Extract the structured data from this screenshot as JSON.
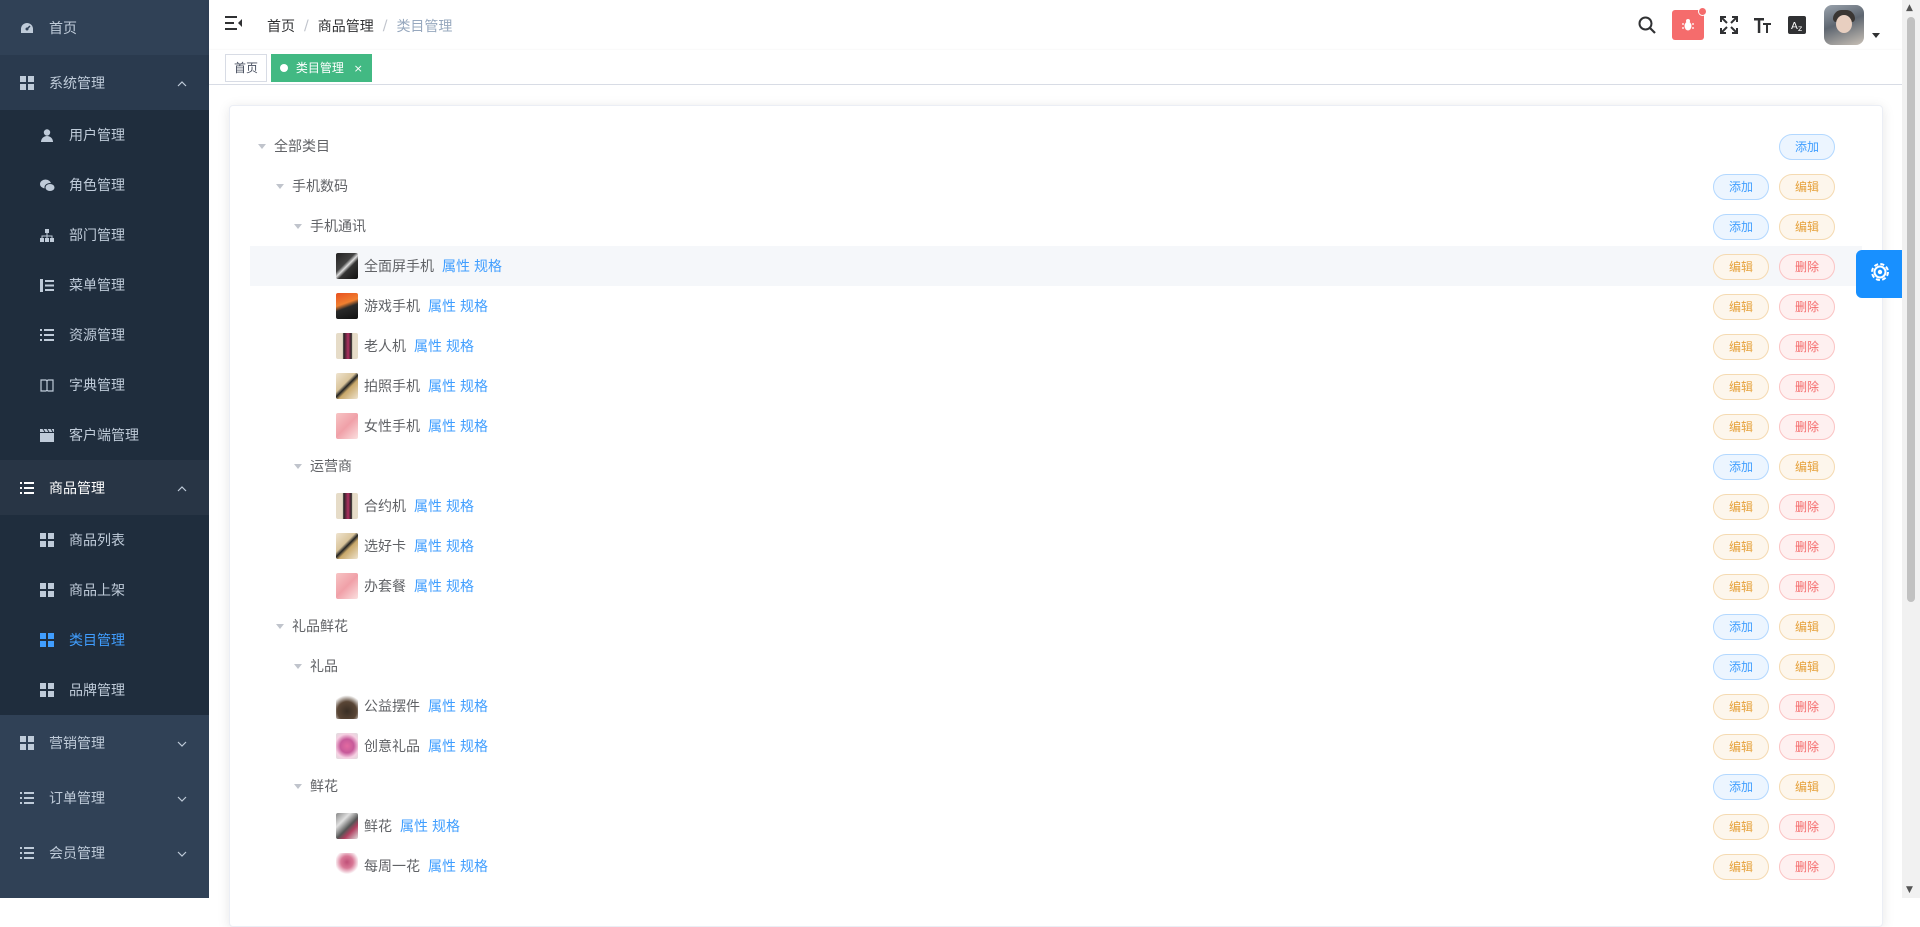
{
  "sidebar": {
    "home": "首页",
    "system": {
      "label": "系统管理",
      "items": [
        "用户管理",
        "角色管理",
        "部门管理",
        "菜单管理",
        "资源管理",
        "字典管理",
        "客户端管理"
      ]
    },
    "goods": {
      "label": "商品管理",
      "items": [
        "商品列表",
        "商品上架",
        "类目管理",
        "品牌管理"
      ],
      "active": "类目管理"
    },
    "marketing": "营销管理",
    "orders": "订单管理",
    "members": "会员管理"
  },
  "navbar": {
    "breadcrumb": [
      "首页",
      "商品管理",
      "类目管理"
    ],
    "separator": "/"
  },
  "tags": {
    "home": "首页",
    "active": "类目管理",
    "close": "×"
  },
  "tree": {
    "buttons": {
      "add": "添加",
      "edit": "编辑",
      "delete": "删除"
    },
    "links": {
      "attr": "属性",
      "spec": "规格"
    },
    "root": "全部类目",
    "cat1": "手机数码",
    "cat1_1": "手机通讯",
    "cat1_1_items": [
      "全面屏手机",
      "游戏手机",
      "老人机",
      "拍照手机",
      "女性手机"
    ],
    "cat1_2": "运营商",
    "cat1_2_items": [
      "合约机",
      "选好卡",
      "办套餐"
    ],
    "cat2": "礼品鲜花",
    "cat2_1": "礼品",
    "cat2_1_items": [
      "公益摆件",
      "创意礼品"
    ],
    "cat2_2": "鲜花",
    "cat2_2_items": [
      "鲜花",
      "每周一花"
    ]
  },
  "colors": {
    "sidebar_bg": "#304156",
    "submenu_bg": "#1f2d3d",
    "active_menu": "#409eff",
    "tag_active": "#42b983",
    "bug_red": "#f56c6c",
    "settings_blue": "#1890ff"
  }
}
